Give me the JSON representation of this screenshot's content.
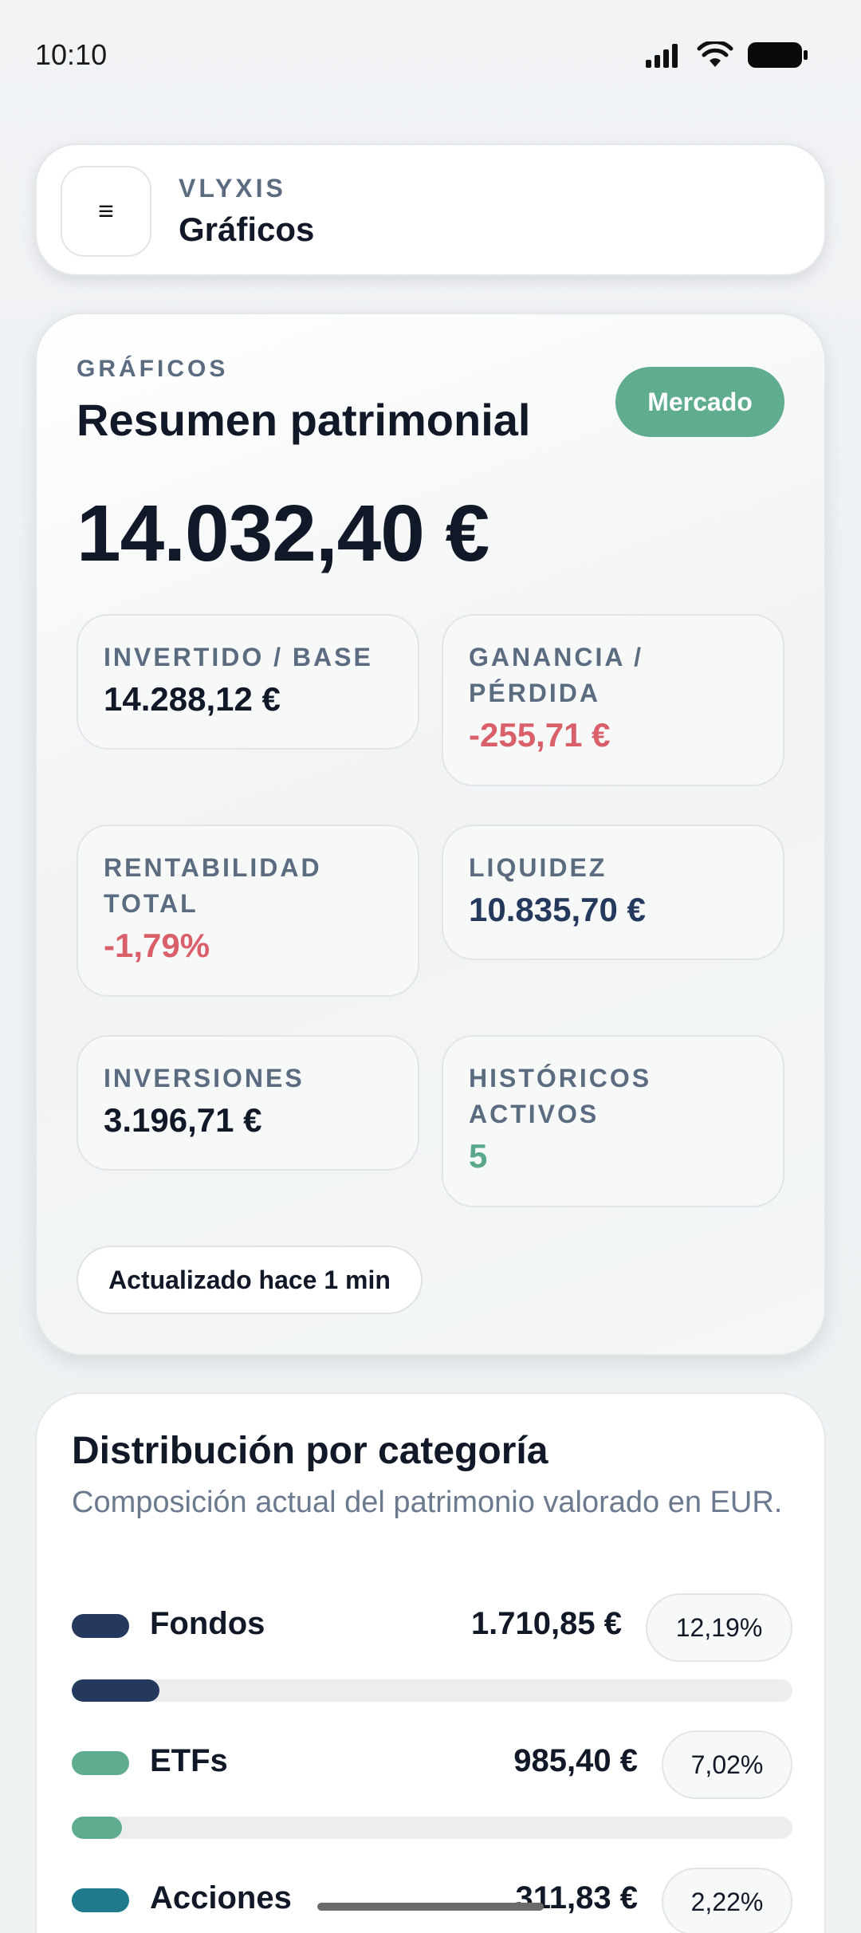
{
  "status_bar": {
    "time": "10:10"
  },
  "header": {
    "menu_glyph": "≡",
    "brand": "VLYXIS",
    "title": "Gráficos"
  },
  "summary": {
    "eyebrow": "GRÁFICOS",
    "title": "Resumen patrimonial",
    "market_button": "Mercado",
    "total": "14.032,40 €",
    "metrics": [
      {
        "label": "INVERTIDO / BASE",
        "value": "14.288,12 €"
      },
      {
        "label": "GANANCIA / PÉRDIDA",
        "value": "-255,71 €"
      },
      {
        "label": "RENTABILIDAD TOTAL",
        "value": "-1,79%"
      },
      {
        "label": "LIQUIDEZ",
        "value": "10.835,70 €"
      },
      {
        "label": "INVERSIONES",
        "value": "3.196,71 €"
      },
      {
        "label": "HISTÓRICOS ACTIVOS",
        "value": "5"
      }
    ],
    "updated": "Actualizado hace 1 min"
  },
  "distribution": {
    "title": "Distribución por categoría",
    "subtitle": "Composición actual del patrimonio valorado en EUR.",
    "categories": [
      {
        "name": "Fondos",
        "amount": "1.710,85 €",
        "percent": "12,19%",
        "share": 0.1219,
        "color": "#25395c"
      },
      {
        "name": "ETFs",
        "amount": "985,40 €",
        "percent": "7,02%",
        "share": 0.0702,
        "color": "#5fad8e"
      },
      {
        "name": "Acciones",
        "amount": "311,83 €",
        "percent": "2,22%",
        "share": 0.0222,
        "color": "#1f7a8c"
      }
    ]
  },
  "colors": {
    "accent": "#5fad8e",
    "negative": "#d9606a",
    "navy": "#25395c"
  }
}
